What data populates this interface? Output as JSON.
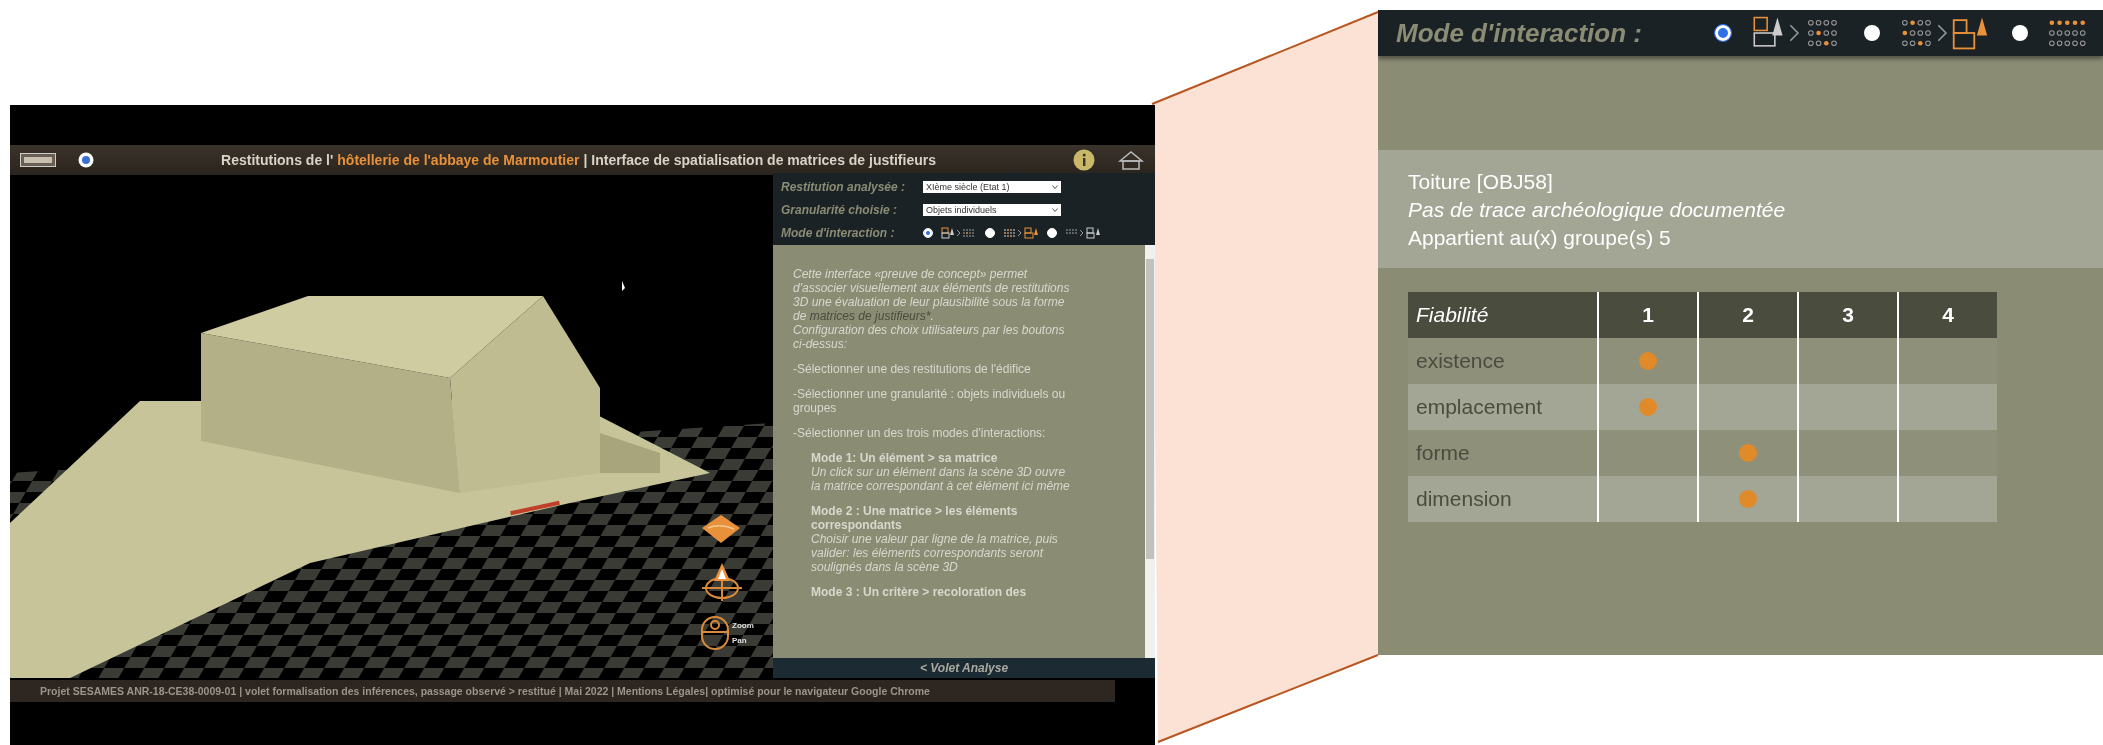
{
  "app": {
    "title_before": "Restitutions de l'",
    "title_link": "hôtellerie de l'abbaye de Marmoutier",
    "title_after": "| Interface de spatialisation de matrices de justifieurs"
  },
  "scene": {
    "zoom_label": "Zoom",
    "pan_label": "Pan"
  },
  "analysis_panel": {
    "fields": [
      {
        "label": "Restitution analysée :",
        "value": "XIème siècle (Etat 1)"
      },
      {
        "label": "Granularité choisie :",
        "value": "Objets individuels"
      }
    ],
    "mode_label": "Mode d'interaction :",
    "modes": [
      {
        "kind": "object-to-matrix",
        "selected": true
      },
      {
        "kind": "matrix-to-object",
        "selected": false
      },
      {
        "kind": "criterion-to-object",
        "selected": false
      }
    ],
    "intro": {
      "text": "Cette interface «preuve de concept» permet d'associer visuellement aux éléments de restitutions 3D une évaluation de leur plausibilité sous la forme de",
      "link": "matrices de justifieurs*",
      "end": "."
    },
    "blocks": [
      {
        "kind": "para",
        "text": "Configuration des choix utilisateurs par les boutons ci-dessus:"
      },
      {
        "kind": "bullet",
        "text": "-Sélectionner une des restitutions de l'édifice"
      },
      {
        "kind": "bullet",
        "text": "-Sélectionner une granularité : objets individuels ou groupes"
      },
      {
        "kind": "bullet",
        "text": "-Sélectionner un des trois modes d'interactions:"
      },
      {
        "kind": "mode-title",
        "text": "Mode 1: Un élément > sa matrice"
      },
      {
        "kind": "mode-desc",
        "text": "Un click sur un élément dans la scène 3D ouvre la matrice correspondant à cet élément ici même"
      },
      {
        "kind": "mode-title",
        "text": "Mode 2 : Une matrice > les éléments correspondants"
      },
      {
        "kind": "mode-desc",
        "text": "Choisir une valeur par ligne de la matrice, puis valider: les éléments correspondants seront soulignés dans la scène 3D"
      },
      {
        "kind": "mode-title",
        "text": "Mode 3 : Un critère > recoloration des"
      }
    ],
    "toggle": "< Volet Analyse"
  },
  "footer": "Projet SESAMES ANR-18-CE38-0009-01 | volet formalisation des inférences, passage observé > restitué | Mai 2022 | Mentions Légales| optimisé pour le navigateur Google Chrome",
  "inset": {
    "mode_label": "Mode d'interaction :",
    "modes": [
      {
        "kind": "object-to-matrix",
        "selected": true
      },
      {
        "kind": "matrix-to-object",
        "selected": false
      },
      {
        "kind": "criterion-to-object",
        "selected": false
      }
    ],
    "object": {
      "name": "Toiture [OBJ58]",
      "note": "Pas de trace archéologique documentée",
      "groups": "Appartient au(x) groupe(s) 5"
    },
    "table": {
      "columns": [
        "Fiabilité",
        "1",
        "2",
        "3",
        "4"
      ],
      "rows": [
        {
          "label": "existence",
          "cells": [
            {
              "selected": true
            },
            {
              "selected": false
            },
            {
              "selected": false
            },
            {
              "selected": false
            }
          ]
        },
        {
          "label": "emplacement",
          "cells": [
            {
              "selected": true
            },
            {
              "selected": false
            },
            {
              "selected": false
            },
            {
              "selected": false
            }
          ]
        },
        {
          "label": "forme",
          "cells": [
            {
              "selected": false
            },
            {
              "selected": true
            },
            {
              "selected": false
            },
            {
              "selected": false
            }
          ]
        },
        {
          "label": "dimension",
          "cells": [
            {
              "selected": false
            },
            {
              "selected": true
            },
            {
              "selected": false
            },
            {
              "selected": false
            }
          ]
        }
      ]
    }
  }
}
